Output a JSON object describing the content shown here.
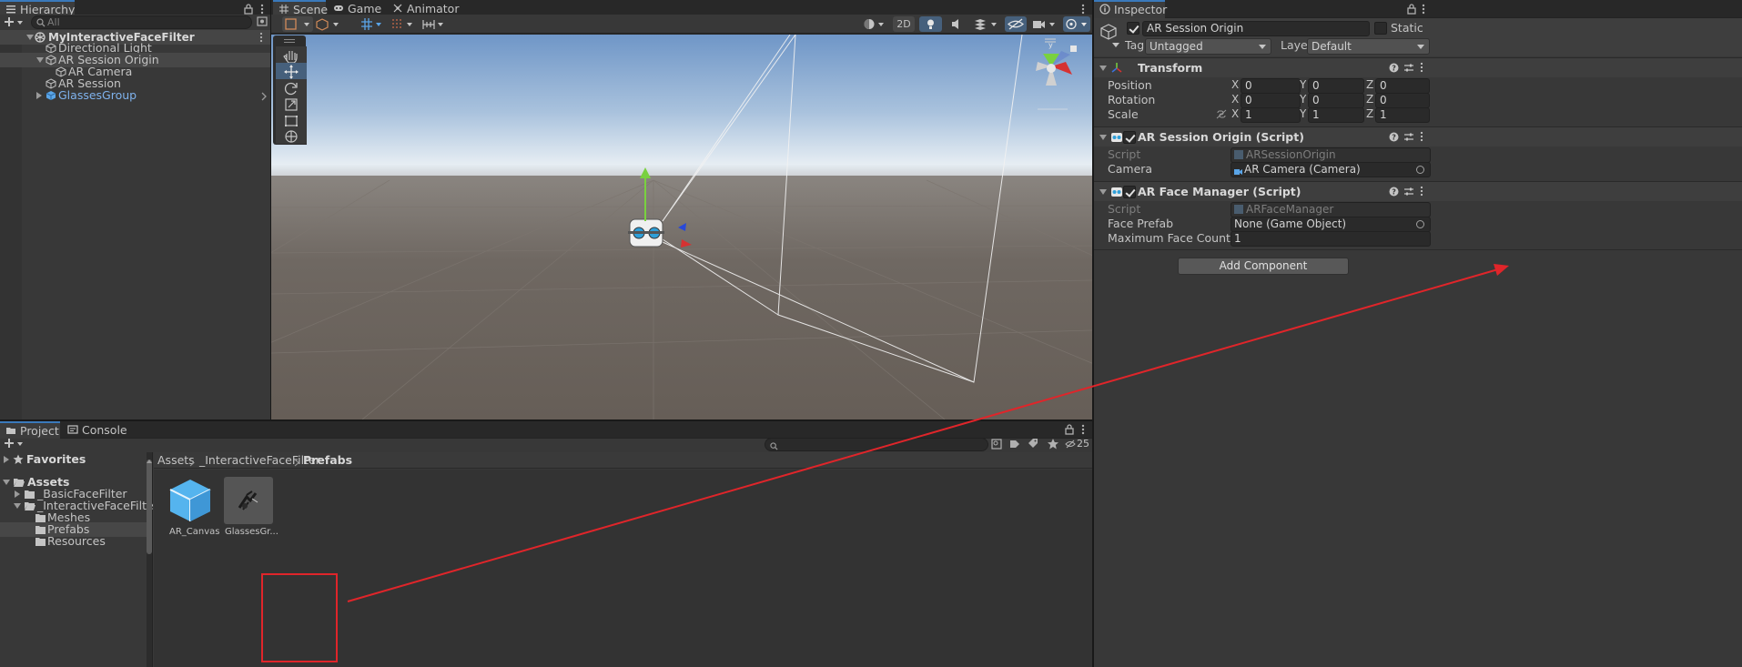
{
  "hierarchy": {
    "tab_label": "Hierarchy",
    "search_placeholder": "All",
    "scene_name": "MyInteractiveFaceFilter",
    "items": [
      {
        "label": "Directional Light"
      },
      {
        "label": "AR Session Origin"
      },
      {
        "label": "AR Camera"
      },
      {
        "label": "AR Session"
      },
      {
        "label": "GlassesGroup"
      }
    ]
  },
  "scene_view": {
    "tabs": [
      {
        "label": "Scene"
      },
      {
        "label": "Game"
      },
      {
        "label": "Animator"
      }
    ],
    "toggle_2d_label": "2D"
  },
  "inspector": {
    "tab_label": "Inspector",
    "object_name": "AR Session Origin",
    "static_label": "Static",
    "tag_label": "Tag",
    "tag_value": "Untagged",
    "layer_label": "Layer",
    "layer_value": "Default",
    "transform": {
      "title": "Transform",
      "position_label": "Position",
      "rotation_label": "Rotation",
      "scale_label": "Scale",
      "axis_x": "X",
      "axis_y": "Y",
      "axis_z": "Z",
      "position": [
        "0",
        "0",
        "0"
      ],
      "rotation": [
        "0",
        "0",
        "0"
      ],
      "scale": [
        "1",
        "1",
        "1"
      ]
    },
    "session_origin": {
      "title": "AR Session Origin (Script)",
      "script_label": "Script",
      "script_value": "ARSessionOrigin",
      "camera_label": "Camera",
      "camera_value": "AR Camera (Camera)"
    },
    "face_manager": {
      "title": "AR Face Manager (Script)",
      "script_label": "Script",
      "script_value": "ARFaceManager",
      "prefab_label": "Face Prefab",
      "prefab_value": "None (Game Object)",
      "max_label": "Maximum Face Count",
      "max_value": "1"
    },
    "add_component_label": "Add Component"
  },
  "project": {
    "tabs": [
      {
        "label": "Project"
      },
      {
        "label": "Console"
      }
    ],
    "hidden_count": "25",
    "breadcrumb": [
      "Assets",
      "_InteractiveFaceFilter",
      "Prefabs"
    ],
    "favorites_label": "Favorites",
    "tree": [
      {
        "label": "Assets"
      },
      {
        "label": "_BasicFaceFilter"
      },
      {
        "label": "_InteractiveFaceFilter"
      },
      {
        "label": "Meshes"
      },
      {
        "label": "Prefabs"
      },
      {
        "label": "Resources"
      }
    ],
    "assets": [
      {
        "label": "AR_Canvas"
      },
      {
        "label": "GlassesGr..."
      }
    ]
  },
  "colors": {
    "accent_blue": "#3a79bb",
    "prefab_blue": "#7fb2ec",
    "annotation_red": "#e0252a"
  }
}
